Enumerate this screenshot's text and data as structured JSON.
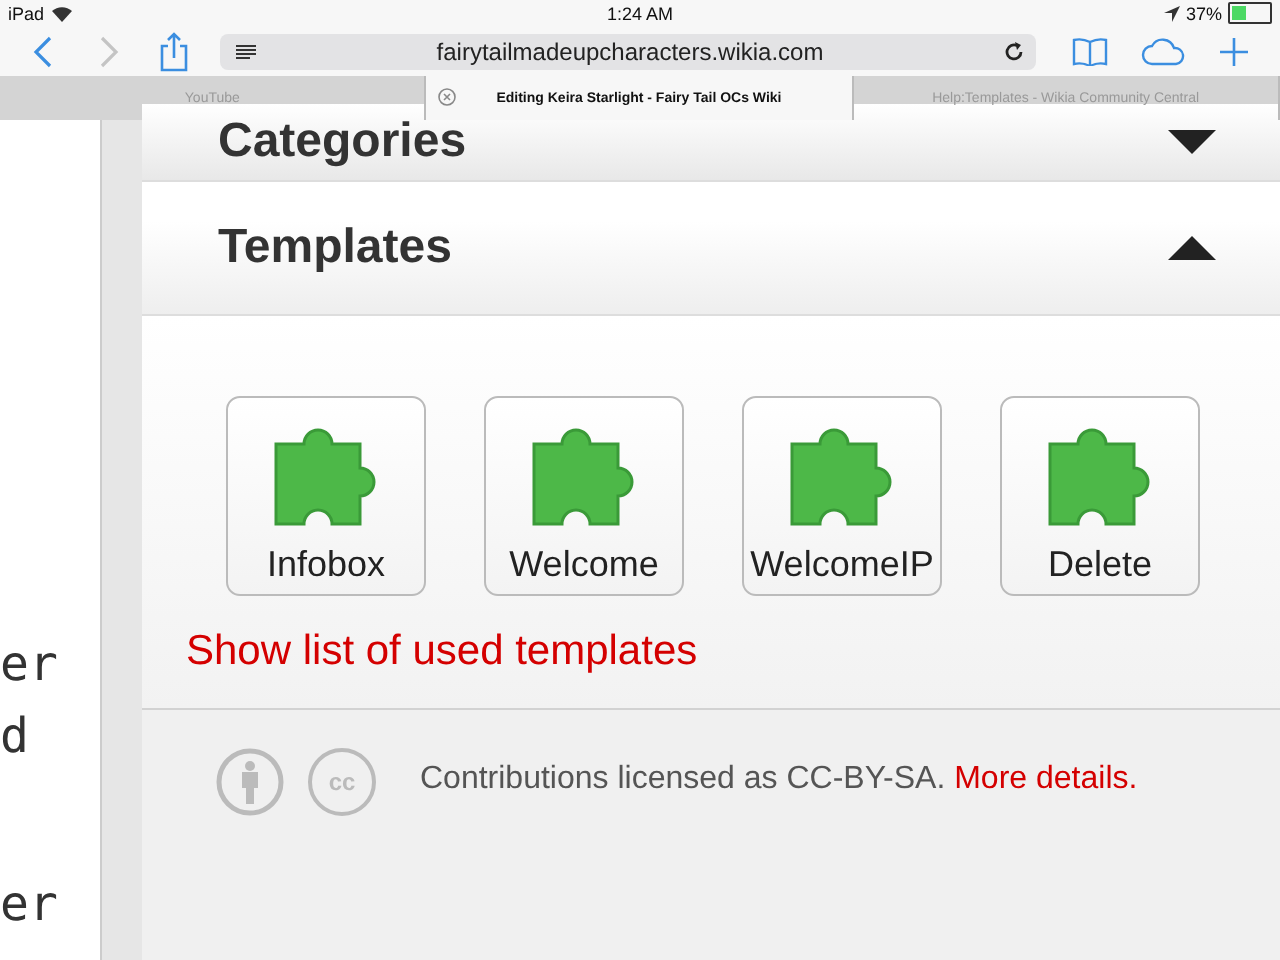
{
  "status_bar": {
    "device": "iPad",
    "time": "1:24 AM",
    "battery": "37%"
  },
  "toolbar": {
    "url": "fairytailmadeupcharacters.wikia.com"
  },
  "tabs": [
    {
      "label": "YouTube",
      "selected": false,
      "closable": false
    },
    {
      "label": "Editing Keira Starlight - Fairy Tail OCs Wiki",
      "selected": true,
      "closable": true
    },
    {
      "label": "Help:Templates - Wikia Community Central",
      "selected": false,
      "closable": false
    }
  ],
  "editor_fragments": [
    "er",
    "d",
    "er"
  ],
  "sections": [
    {
      "title": "Categories",
      "expanded": false
    },
    {
      "title": "Templates",
      "expanded": true
    }
  ],
  "templates": [
    {
      "label": "Infobox"
    },
    {
      "label": "Welcome"
    },
    {
      "label": "WelcomeIP"
    },
    {
      "label": "Delete"
    }
  ],
  "templates_link": "Show list of used templates",
  "footer": {
    "cc_mark": "cc",
    "text": "Contributions licensed as CC-BY-SA.",
    "link": "More details."
  }
}
